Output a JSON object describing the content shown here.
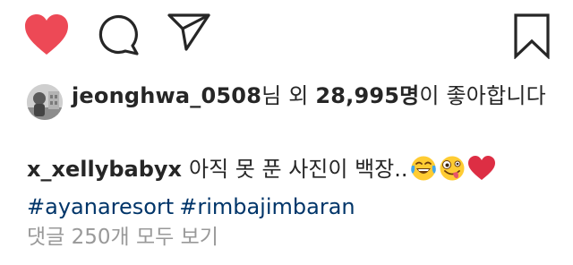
{
  "actions": {
    "like_icon": "heart-filled-icon",
    "comment_icon": "speech-bubble-icon",
    "share_icon": "paper-plane-icon",
    "save_icon": "bookmark-icon",
    "like_color": "#ed4956"
  },
  "likes": {
    "username": "jeonghwa_0508",
    "text_after_user": "님 외 ",
    "count": "28,995명",
    "text_after_count": "이 좋아합니다"
  },
  "caption": {
    "username": "x_xellybabyx",
    "text": "아직 못 푼 사진이 백장..",
    "emojis": [
      "tears-of-joy-emoji",
      "zany-face-emoji",
      "red-heart-emoji"
    ],
    "hashtags": [
      "#ayanaresort",
      "#rimbajimbaran"
    ]
  },
  "comments": {
    "view_all_label": "댓글 250개 모두 보기"
  }
}
